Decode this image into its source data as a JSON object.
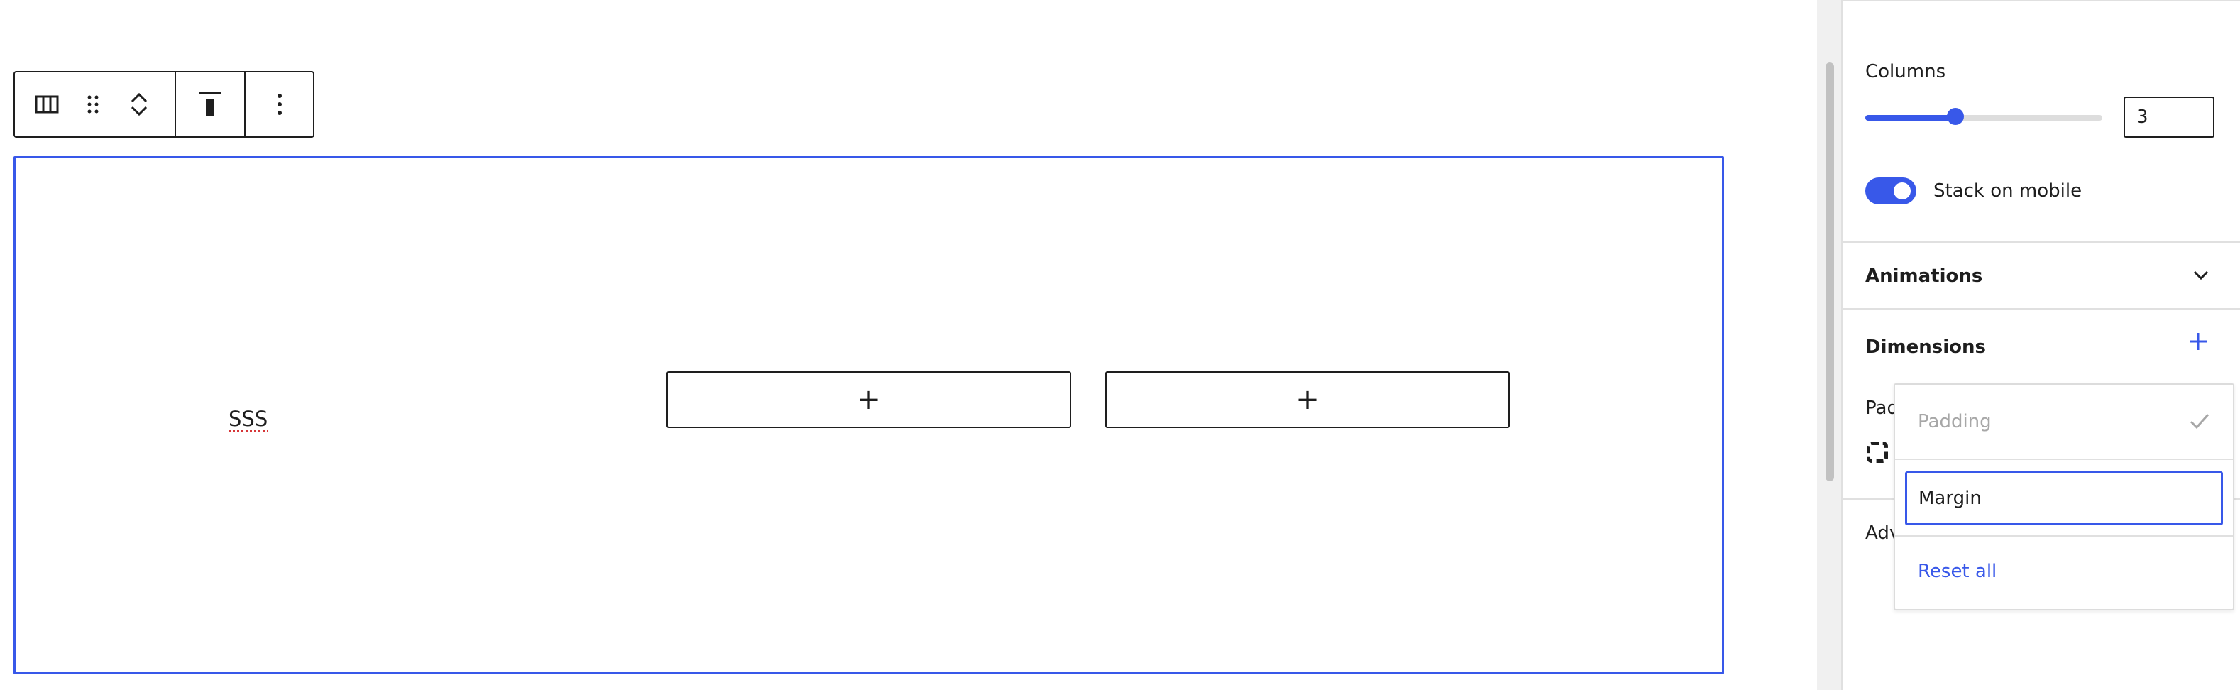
{
  "colors": {
    "accent": "#3858e9",
    "text": "#1e1e1e",
    "muted": "#a7a7a7",
    "border": "#e0e0e0"
  },
  "toolbar": {
    "icons": [
      "columns-icon",
      "drag-handle-icon",
      "move-up-down-icon",
      "align-top-icon",
      "more-options-icon"
    ]
  },
  "canvas": {
    "column_1_text": "SSS",
    "appender_symbol": "+"
  },
  "sidebar": {
    "columns_label": "Columns",
    "columns_value": "3",
    "columns_slider_fraction": 0.4,
    "stack_on_mobile_label": "Stack on mobile",
    "stack_on_mobile": true,
    "animations_title": "Animations",
    "dimensions_title": "Dimensions",
    "padding_label_partial": "Pad",
    "advanced_title_partial": "Adv"
  },
  "dimensions_menu": {
    "items": [
      {
        "label": "Padding",
        "checked": true,
        "disabled": true
      },
      {
        "label": "Margin",
        "checked": false,
        "focused": true
      }
    ],
    "reset_label": "Reset all"
  }
}
